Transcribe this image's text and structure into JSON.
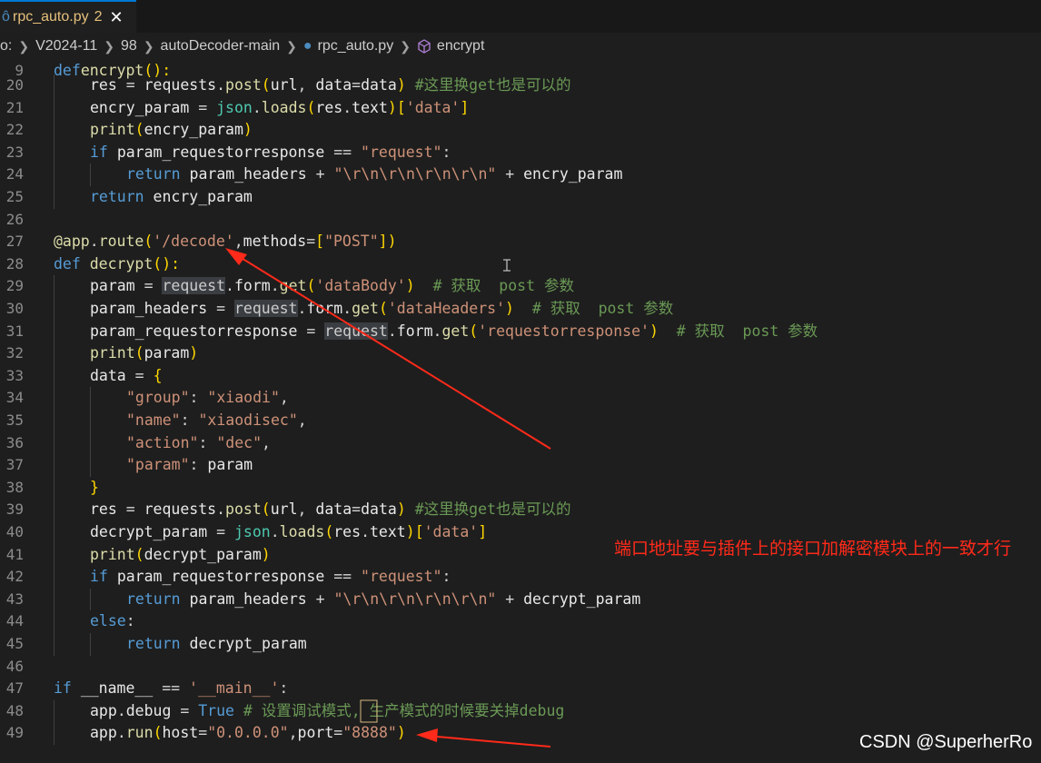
{
  "tab": {
    "filename": "rpc_auto.py",
    "problem_count": "2",
    "close_glyph": "✕"
  },
  "breadcrumbs": [
    {
      "text": "o:"
    },
    {
      "text": "V2024-11"
    },
    {
      "text": "98"
    },
    {
      "text": "autoDecoder-main"
    },
    {
      "text": "rpc_auto.py"
    },
    {
      "text": "encrypt"
    }
  ],
  "sticky": {
    "num": "9",
    "tokens": [
      [
        "kw",
        "def"
      ],
      [
        "",
        ""
      ],
      [
        "fn",
        "encrypt"
      ],
      [
        "br",
        "():"
      ]
    ]
  },
  "lines": [
    {
      "num": "20",
      "indent": 1,
      "tokens": [
        [
          "var",
          "res"
        ],
        [
          "op",
          " = "
        ],
        [
          "var",
          "requests"
        ],
        [
          "op",
          "."
        ],
        [
          "fn",
          "post"
        ],
        [
          "br",
          "("
        ],
        [
          "var",
          "url"
        ],
        [
          "op",
          ", "
        ],
        [
          "var",
          "data"
        ],
        [
          "op",
          "="
        ],
        [
          "var",
          "data"
        ],
        [
          "br",
          ")"
        ],
        [
          "op",
          " "
        ],
        [
          "cm",
          "#这里换get也是可以的"
        ]
      ]
    },
    {
      "num": "21",
      "indent": 1,
      "tokens": [
        [
          "var",
          "encry_param"
        ],
        [
          "op",
          " = "
        ],
        [
          "cls",
          "json"
        ],
        [
          "op",
          "."
        ],
        [
          "fn",
          "loads"
        ],
        [
          "br",
          "("
        ],
        [
          "var",
          "res"
        ],
        [
          "op",
          "."
        ],
        [
          "var",
          "text"
        ],
        [
          "br",
          ")"
        ],
        [
          "br",
          "["
        ],
        [
          "str",
          "'data'"
        ],
        [
          "br",
          "]"
        ]
      ]
    },
    {
      "num": "22",
      "indent": 1,
      "tokens": [
        [
          "fn",
          "print"
        ],
        [
          "br",
          "("
        ],
        [
          "var",
          "encry_param"
        ],
        [
          "br",
          ")"
        ]
      ]
    },
    {
      "num": "23",
      "indent": 1,
      "tokens": [
        [
          "kw",
          "if"
        ],
        [
          "op",
          " "
        ],
        [
          "var",
          "param_requestorresponse"
        ],
        [
          "op",
          " == "
        ],
        [
          "str",
          "\"request\""
        ],
        [
          "op",
          ":"
        ]
      ]
    },
    {
      "num": "24",
      "indent": 2,
      "tokens": [
        [
          "kw",
          "return"
        ],
        [
          "op",
          " "
        ],
        [
          "var",
          "param_headers"
        ],
        [
          "op",
          " + "
        ],
        [
          "str",
          "\"\\r\\n\\r\\n\\r\\n\\r\\n\""
        ],
        [
          "op",
          " + "
        ],
        [
          "var",
          "encry_param"
        ]
      ]
    },
    {
      "num": "25",
      "indent": 1,
      "tokens": [
        [
          "kw",
          "return"
        ],
        [
          "op",
          " "
        ],
        [
          "var",
          "encry_param"
        ]
      ]
    },
    {
      "num": "26",
      "indent": 0,
      "tokens": []
    },
    {
      "num": "27",
      "indent": 0,
      "tokens": [
        [
          "dec",
          "@app"
        ],
        [
          "op",
          "."
        ],
        [
          "fn",
          "route"
        ],
        [
          "br",
          "("
        ],
        [
          "str",
          "'/decode'"
        ],
        [
          "op",
          ","
        ],
        [
          "var",
          "methods"
        ],
        [
          "op",
          "="
        ],
        [
          "br",
          "["
        ],
        [
          "str",
          "\"POST\""
        ],
        [
          "br",
          "])"
        ]
      ]
    },
    {
      "num": "28",
      "indent": 0,
      "tokens": [
        [
          "kw",
          "def"
        ],
        [
          "op",
          " "
        ],
        [
          "fn",
          "decrypt"
        ],
        [
          "br",
          "():"
        ]
      ]
    },
    {
      "num": "29",
      "indent": 1,
      "tokens": [
        [
          "var",
          "param"
        ],
        [
          "op",
          " = "
        ],
        [
          "hl",
          "request"
        ],
        [
          "op",
          "."
        ],
        [
          "var",
          "form"
        ],
        [
          "op",
          "."
        ],
        [
          "fn",
          "get"
        ],
        [
          "br",
          "("
        ],
        [
          "str",
          "'dataBody'"
        ],
        [
          "br",
          ")"
        ],
        [
          "op",
          "  "
        ],
        [
          "cm",
          "# 获取  post 参数"
        ]
      ]
    },
    {
      "num": "30",
      "indent": 1,
      "tokens": [
        [
          "var",
          "param_headers"
        ],
        [
          "op",
          " = "
        ],
        [
          "hl",
          "request"
        ],
        [
          "op",
          "."
        ],
        [
          "var",
          "form"
        ],
        [
          "op",
          "."
        ],
        [
          "fn",
          "get"
        ],
        [
          "br",
          "("
        ],
        [
          "str",
          "'dataHeaders'"
        ],
        [
          "br",
          ")"
        ],
        [
          "op",
          "  "
        ],
        [
          "cm",
          "# 获取  post 参数"
        ]
      ]
    },
    {
      "num": "31",
      "indent": 1,
      "tokens": [
        [
          "var",
          "param_requestorresponse"
        ],
        [
          "op",
          " = "
        ],
        [
          "hl",
          "request"
        ],
        [
          "op",
          "."
        ],
        [
          "var",
          "form"
        ],
        [
          "op",
          "."
        ],
        [
          "fn",
          "get"
        ],
        [
          "br",
          "("
        ],
        [
          "str",
          "'requestorresponse'"
        ],
        [
          "br",
          ")"
        ],
        [
          "op",
          "  "
        ],
        [
          "cm",
          "# 获取  post 参数"
        ]
      ]
    },
    {
      "num": "32",
      "indent": 1,
      "tokens": [
        [
          "fn",
          "print"
        ],
        [
          "br",
          "("
        ],
        [
          "var",
          "param"
        ],
        [
          "br",
          ")"
        ]
      ]
    },
    {
      "num": "33",
      "indent": 1,
      "tokens": [
        [
          "var",
          "data"
        ],
        [
          "op",
          " = "
        ],
        [
          "br",
          "{"
        ]
      ]
    },
    {
      "num": "34",
      "indent": 2,
      "tokens": [
        [
          "str",
          "\"group\""
        ],
        [
          "op",
          ": "
        ],
        [
          "str",
          "\"xiaodi\""
        ],
        [
          "op",
          ","
        ]
      ]
    },
    {
      "num": "35",
      "indent": 2,
      "tokens": [
        [
          "str",
          "\"name\""
        ],
        [
          "op",
          ": "
        ],
        [
          "str",
          "\"xiaodisec\""
        ],
        [
          "op",
          ","
        ]
      ]
    },
    {
      "num": "36",
      "indent": 2,
      "tokens": [
        [
          "str",
          "\"action\""
        ],
        [
          "op",
          ": "
        ],
        [
          "str",
          "\"dec\""
        ],
        [
          "op",
          ","
        ]
      ]
    },
    {
      "num": "37",
      "indent": 2,
      "tokens": [
        [
          "str",
          "\"param\""
        ],
        [
          "op",
          ": "
        ],
        [
          "var",
          "param"
        ]
      ]
    },
    {
      "num": "38",
      "indent": 1,
      "tokens": [
        [
          "br",
          "}"
        ]
      ]
    },
    {
      "num": "39",
      "indent": 1,
      "tokens": [
        [
          "var",
          "res"
        ],
        [
          "op",
          " = "
        ],
        [
          "var",
          "requests"
        ],
        [
          "op",
          "."
        ],
        [
          "fn",
          "post"
        ],
        [
          "br",
          "("
        ],
        [
          "var",
          "url"
        ],
        [
          "op",
          ", "
        ],
        [
          "var",
          "data"
        ],
        [
          "op",
          "="
        ],
        [
          "var",
          "data"
        ],
        [
          "br",
          ")"
        ],
        [
          "op",
          " "
        ],
        [
          "cm",
          "#这里换get也是可以的"
        ]
      ]
    },
    {
      "num": "40",
      "indent": 1,
      "tokens": [
        [
          "var",
          "decrypt_param"
        ],
        [
          "op",
          " = "
        ],
        [
          "cls",
          "json"
        ],
        [
          "op",
          "."
        ],
        [
          "fn",
          "loads"
        ],
        [
          "br",
          "("
        ],
        [
          "var",
          "res"
        ],
        [
          "op",
          "."
        ],
        [
          "var",
          "text"
        ],
        [
          "br",
          ")"
        ],
        [
          "br",
          "["
        ],
        [
          "str",
          "'data'"
        ],
        [
          "br",
          "]"
        ]
      ]
    },
    {
      "num": "41",
      "indent": 1,
      "tokens": [
        [
          "fn",
          "print"
        ],
        [
          "br",
          "("
        ],
        [
          "var",
          "decrypt_param"
        ],
        [
          "br",
          ")"
        ]
      ]
    },
    {
      "num": "42",
      "indent": 1,
      "tokens": [
        [
          "kw",
          "if"
        ],
        [
          "op",
          " "
        ],
        [
          "var",
          "param_requestorresponse"
        ],
        [
          "op",
          " == "
        ],
        [
          "str",
          "\"request\""
        ],
        [
          "op",
          ":"
        ]
      ]
    },
    {
      "num": "43",
      "indent": 2,
      "tokens": [
        [
          "kw",
          "return"
        ],
        [
          "op",
          " "
        ],
        [
          "var",
          "param_headers"
        ],
        [
          "op",
          " + "
        ],
        [
          "str",
          "\"\\r\\n\\r\\n\\r\\n\\r\\n\""
        ],
        [
          "op",
          " + "
        ],
        [
          "var",
          "decrypt_param"
        ]
      ]
    },
    {
      "num": "44",
      "indent": 1,
      "tokens": [
        [
          "kw",
          "else"
        ],
        [
          "op",
          ":"
        ]
      ]
    },
    {
      "num": "45",
      "indent": 2,
      "tokens": [
        [
          "kw",
          "return"
        ],
        [
          "op",
          " "
        ],
        [
          "var",
          "decrypt_param"
        ]
      ]
    },
    {
      "num": "46",
      "indent": 0,
      "tokens": []
    },
    {
      "num": "47",
      "indent": 0,
      "tokens": [
        [
          "kw",
          "if"
        ],
        [
          "op",
          " "
        ],
        [
          "var",
          "__name__"
        ],
        [
          "op",
          " == "
        ],
        [
          "str",
          "'__main__'"
        ],
        [
          "op",
          ":"
        ]
      ]
    },
    {
      "num": "48",
      "indent": 1,
      "tokens": [
        [
          "var",
          "app"
        ],
        [
          "op",
          "."
        ],
        [
          "var",
          "debug"
        ],
        [
          "op",
          " = "
        ],
        [
          "kw",
          "True"
        ],
        [
          "op",
          " "
        ],
        [
          "cm",
          "# 设置调试模式, 生产模式的时候要关掉debug"
        ]
      ]
    },
    {
      "num": "49",
      "indent": 1,
      "tokens": [
        [
          "var",
          "app"
        ],
        [
          "op",
          "."
        ],
        [
          "fn",
          "run"
        ],
        [
          "br",
          "("
        ],
        [
          "var",
          "host"
        ],
        [
          "op",
          "="
        ],
        [
          "str",
          "\"0.0.0.0\""
        ],
        [
          "op",
          ","
        ],
        [
          "var",
          "port"
        ],
        [
          "op",
          "="
        ],
        [
          "str",
          "\"8888\""
        ],
        [
          "br",
          ")"
        ]
      ]
    }
  ],
  "annotation": {
    "text": "端口地址要与插件上的接口加解密模块上的一致才行",
    "color": "#ff2a1a"
  },
  "watermark": "CSDN @SuperherRo",
  "colors": {
    "keyword": "#569cd6",
    "function": "#dcdcaa",
    "string": "#ce9178",
    "comment": "#6a9955",
    "arrow": "#ff2a1a"
  }
}
